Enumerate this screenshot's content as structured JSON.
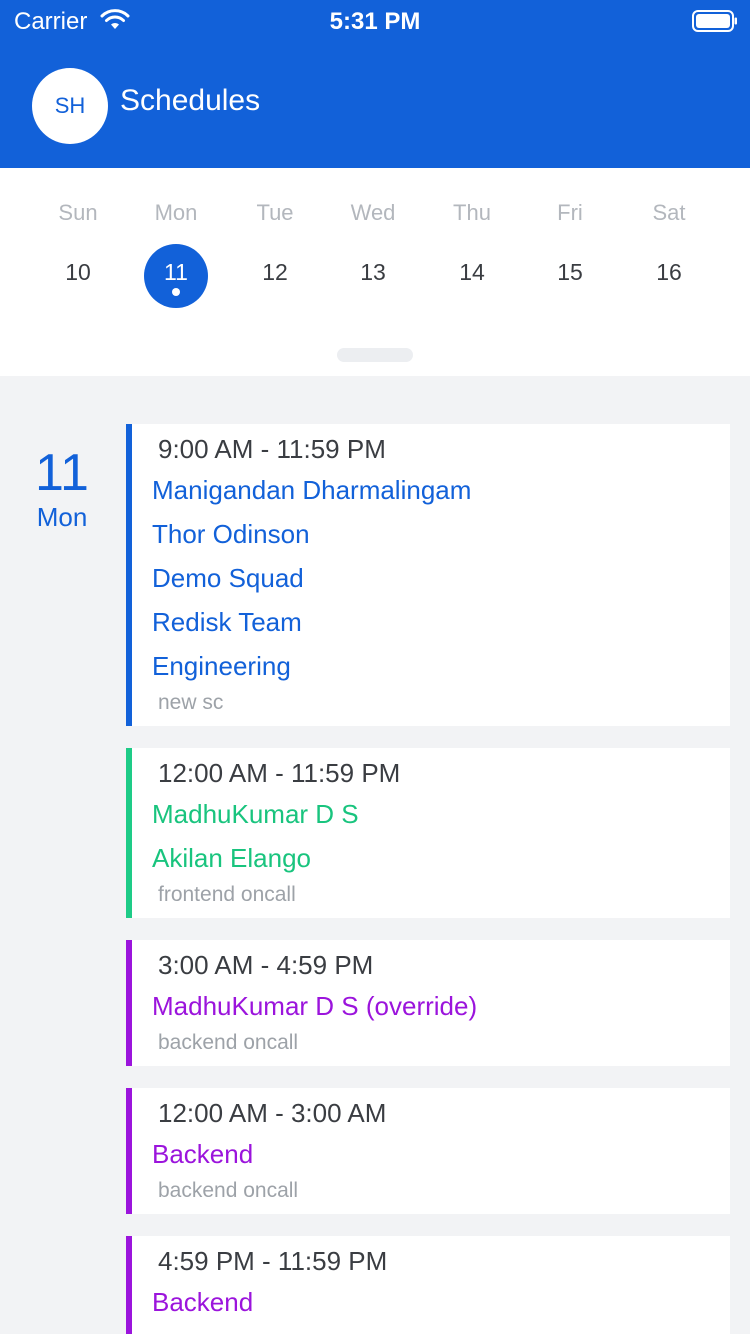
{
  "status_bar": {
    "carrier": "Carrier",
    "time": "5:31 PM"
  },
  "header": {
    "avatar_initials": "SH",
    "title": "Schedules"
  },
  "week": {
    "days": [
      {
        "name": "Sun",
        "num": "10",
        "selected": false
      },
      {
        "name": "Mon",
        "num": "11",
        "selected": true
      },
      {
        "name": "Tue",
        "num": "12",
        "selected": false
      },
      {
        "name": "Wed",
        "num": "13",
        "selected": false
      },
      {
        "name": "Thu",
        "num": "14",
        "selected": false
      },
      {
        "name": "Fri",
        "num": "15",
        "selected": false
      },
      {
        "name": "Sat",
        "num": "16",
        "selected": false
      }
    ]
  },
  "agenda": {
    "date_num": "11",
    "date_weekday": "Mon",
    "entries": [
      {
        "time": "9:00 AM - 11:59 PM",
        "people": [
          "Manigandan Dharmalingam",
          "Thor Odinson",
          "Demo Squad",
          "Redisk Team",
          "Engineering"
        ],
        "schedule": "new sc",
        "color": "#1261d9"
      },
      {
        "time": "12:00 AM - 11:59 PM",
        "people": [
          "MadhuKumar D S",
          "Akilan Elango"
        ],
        "schedule": "frontend oncall",
        "color": "#1ecb87"
      },
      {
        "time": "3:00 AM - 4:59 PM",
        "people": [
          "MadhuKumar D S (override)"
        ],
        "schedule": "backend oncall",
        "color": "#9b14dc"
      },
      {
        "time": "12:00 AM - 3:00 AM",
        "people": [
          "Backend"
        ],
        "schedule": "backend oncall",
        "color": "#9b14dc"
      },
      {
        "time": "4:59 PM - 11:59 PM",
        "people": [
          "Backend"
        ],
        "schedule": "",
        "color": "#9b14dc"
      }
    ]
  },
  "colors": {
    "brand": "#1261d9",
    "green": "#1ecb87",
    "purple": "#9b14dc"
  },
  "icons": {
    "wifi": "wifi-icon",
    "battery": "battery-icon"
  }
}
